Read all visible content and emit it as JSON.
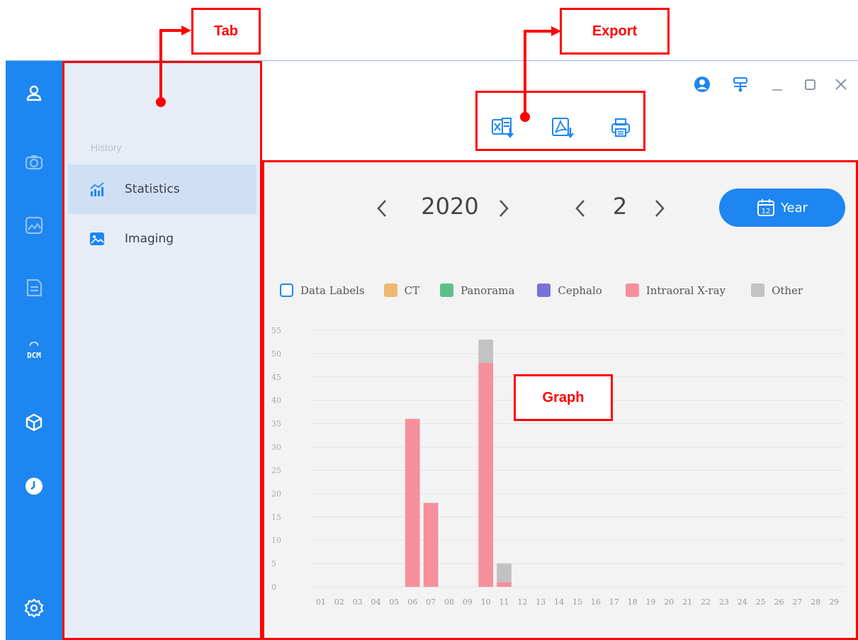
{
  "annotations": {
    "tab": "Tab",
    "export": "Export",
    "graph": "Graph"
  },
  "rail": {
    "icons": [
      "user-icon",
      "camera-icon",
      "image-icon",
      "document-icon",
      "dcm-icon",
      "cube-icon",
      "clock-icon",
      "settings-icon"
    ],
    "dcm_text": "DCM"
  },
  "tabs": {
    "section_label": "History",
    "items": [
      {
        "label": "Statistics",
        "icon": "chart-icon",
        "active": true
      },
      {
        "label": "Imaging",
        "icon": "image-icon",
        "active": false
      }
    ]
  },
  "window": {
    "controls": [
      "account-icon",
      "network-icon",
      "minimize-icon",
      "maximize-icon",
      "close-icon"
    ]
  },
  "export": {
    "buttons": [
      "excel-export-icon",
      "pdf-export-icon",
      "print-icon"
    ]
  },
  "filters": {
    "year": "2020",
    "month": "2",
    "period_button": "Year",
    "calendar_day": "12"
  },
  "legend": {
    "data_labels": "Data Labels",
    "items": [
      {
        "name": "CT",
        "color": "#f0b870"
      },
      {
        "name": "Panorama",
        "color": "#5ec088"
      },
      {
        "name": "Cephalo",
        "color": "#7b6fd8"
      },
      {
        "name": "Intraoral X-ray",
        "color": "#f78f9c"
      },
      {
        "name": "Other",
        "color": "#c2c2c2"
      }
    ]
  },
  "chart_data": {
    "type": "bar",
    "stacked": true,
    "categories": [
      "01",
      "02",
      "03",
      "04",
      "05",
      "06",
      "07",
      "08",
      "09",
      "10",
      "11",
      "12",
      "13",
      "14",
      "15",
      "16",
      "17",
      "18",
      "19",
      "20",
      "21",
      "22",
      "23",
      "24",
      "25",
      "26",
      "27",
      "28",
      "29"
    ],
    "ylim": [
      0,
      55
    ],
    "yticks": [
      0,
      5,
      10,
      15,
      20,
      25,
      30,
      35,
      40,
      45,
      50,
      55
    ],
    "grid": true,
    "series": [
      {
        "name": "CT",
        "color": "#f0b870",
        "values": [
          0,
          0,
          0,
          0,
          0,
          0,
          0,
          0,
          0,
          0,
          0,
          0,
          0,
          0,
          0,
          0,
          0,
          0,
          0,
          0,
          0,
          0,
          0,
          0,
          0,
          0,
          0,
          0,
          0
        ]
      },
      {
        "name": "Panorama",
        "color": "#5ec088",
        "values": [
          0,
          0,
          0,
          0,
          0,
          0,
          0,
          0,
          0,
          0,
          0,
          0,
          0,
          0,
          0,
          0,
          0,
          0,
          0,
          0,
          0,
          0,
          0,
          0,
          0,
          0,
          0,
          0,
          0
        ]
      },
      {
        "name": "Cephalo",
        "color": "#7b6fd8",
        "values": [
          0,
          0,
          0,
          0,
          0,
          0,
          0,
          0,
          0,
          0,
          0,
          0,
          0,
          0,
          0,
          0,
          0,
          0,
          0,
          0,
          0,
          0,
          0,
          0,
          0,
          0,
          0,
          0,
          0
        ]
      },
      {
        "name": "Intraoral X-ray",
        "color": "#f78f9c",
        "values": [
          0,
          0,
          0,
          0,
          0,
          36,
          18,
          0,
          0,
          48,
          1,
          0,
          0,
          0,
          0,
          0,
          0,
          0,
          0,
          0,
          0,
          0,
          0,
          0,
          0,
          0,
          0,
          0,
          0
        ]
      },
      {
        "name": "Other",
        "color": "#c2c2c2",
        "values": [
          0,
          0,
          0,
          0,
          0,
          0,
          0,
          0,
          0,
          5,
          4,
          0,
          0,
          0,
          0,
          0,
          0,
          0,
          0,
          0,
          0,
          0,
          0,
          0,
          0,
          0,
          0,
          0,
          0
        ]
      }
    ]
  }
}
